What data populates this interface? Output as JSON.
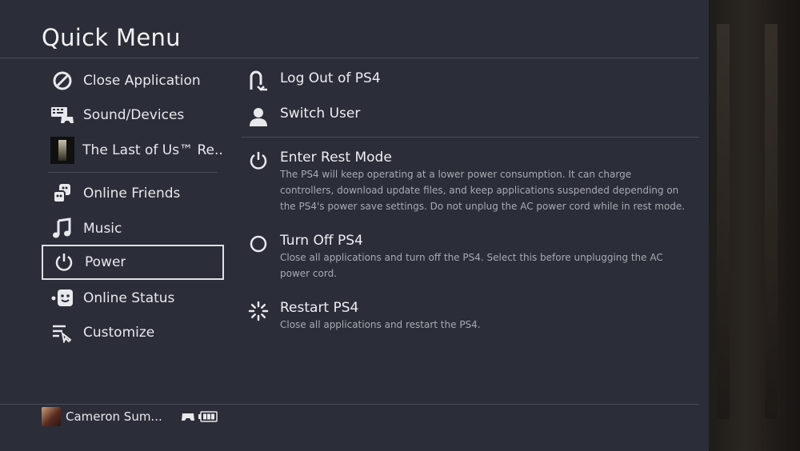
{
  "title": "Quick Menu",
  "left_menu": [
    {
      "label": "Close Application",
      "icon": "close-application-icon"
    },
    {
      "label": "Sound/Devices",
      "icon": "keyboard-controller-icon"
    },
    {
      "label": "The Last of Us™ Re...",
      "icon": "game-thumbnail"
    },
    {
      "label": "Online Friends",
      "icon": "friends-icon"
    },
    {
      "label": "Music",
      "icon": "music-note-icon"
    },
    {
      "label": "Power",
      "icon": "power-icon",
      "selected": true
    },
    {
      "label": "Online Status",
      "icon": "online-status-icon"
    },
    {
      "label": "Customize",
      "icon": "customize-icon"
    }
  ],
  "right_menu": {
    "logout": {
      "label": "Log Out of PS4",
      "icon": "logout-icon"
    },
    "switch_user": {
      "label": "Switch User",
      "icon": "user-icon"
    },
    "rest_mode": {
      "label": "Enter Rest Mode",
      "desc1": "The PS4 will keep operating at a lower power consumption. It can charge",
      "desc2": "controllers, download update files, and keep applications suspended depending on",
      "desc3": "the PS4's power save settings. Do not unplug the AC power cord while in rest mode."
    },
    "turn_off": {
      "label": "Turn Off PS4",
      "desc1": "Close all applications and turn off the PS4. Select this before unplugging the AC",
      "desc2": "power cord."
    },
    "restart": {
      "label": "Restart PS4",
      "desc1": "Close all applications and restart the PS4."
    }
  },
  "footer": {
    "user_name": "Cameron Sum..."
  },
  "colors": {
    "panel": "#2b2d38",
    "selection_border": "#dfe0e4",
    "text": "#e8e9ec",
    "desc": "#a8aab2"
  }
}
